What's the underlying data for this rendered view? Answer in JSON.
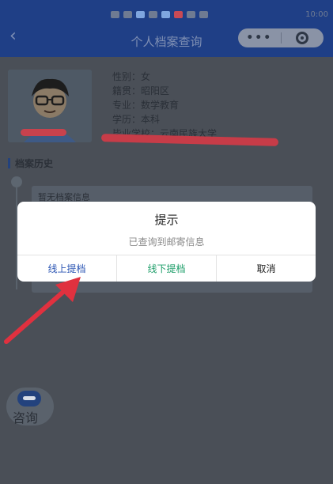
{
  "status_bar": {
    "time": "10:00"
  },
  "nav": {
    "title": "个人档案查询",
    "back_icon": "back-chevron-icon",
    "more_label": "•••"
  },
  "profile": {
    "gender_label": "性别：",
    "gender_value": "女",
    "origin_label": "籍贯：",
    "origin_value": "昭阳区",
    "major_label": "专业：",
    "major_value": "数学教育",
    "degree_label": "学历：",
    "degree_value": "本科",
    "school_label": "毕业学校：",
    "school_value": "云南民族大学"
  },
  "history": {
    "section_title": "档案历史",
    "empty_text": "暂无档案信息"
  },
  "dialog": {
    "title": "提示",
    "message": "已查询到邮寄信息",
    "buttons": {
      "online": "线上提档",
      "offline": "线下提档",
      "cancel": "取消"
    }
  },
  "consult": {
    "label": "咨询"
  },
  "colors": {
    "nav_bg": "#1f3f86",
    "online_btn": "#2c56b4",
    "offline_btn": "#1f9e6a",
    "annotation_red": "#e0313f"
  }
}
